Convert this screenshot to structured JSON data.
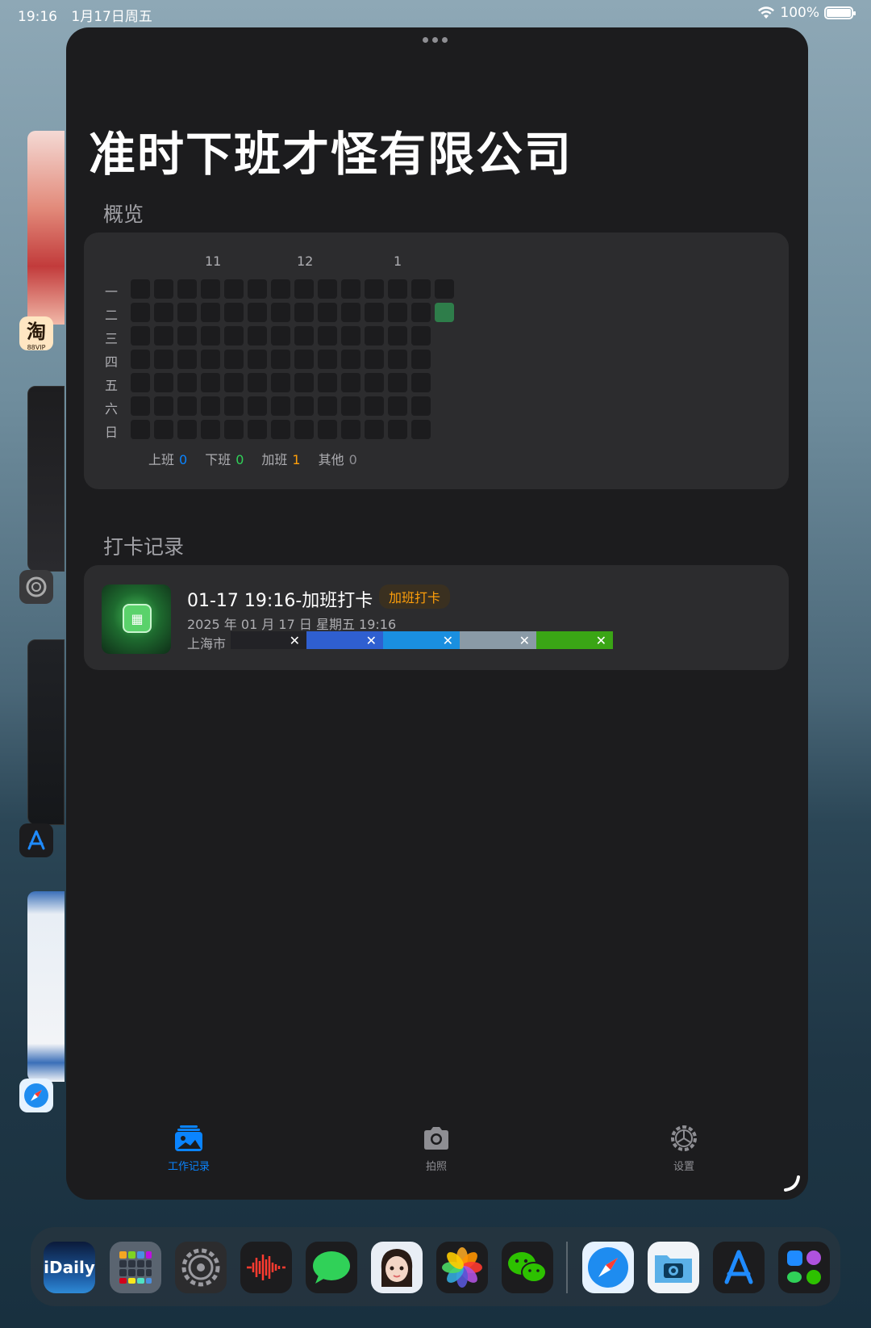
{
  "status_bar": {
    "time": "19:16",
    "date": "1月17日周五",
    "battery": "100%"
  },
  "window": {
    "title": "准时下班才怪有限公司"
  },
  "overview": {
    "heading": "概览",
    "months": [
      "11",
      "12",
      "1"
    ],
    "weekdays": [
      "一",
      "二",
      "三",
      "四",
      "五",
      "六",
      "日"
    ],
    "legend": [
      {
        "label": "上班",
        "value": "0",
        "color": "#0a84ff"
      },
      {
        "label": "下班",
        "value": "0",
        "color": "#30d158"
      },
      {
        "label": "加班",
        "value": "1",
        "color": "#ff9f0a"
      },
      {
        "label": "其他",
        "value": "0",
        "color": "#8e8e93"
      }
    ]
  },
  "records": {
    "heading": "打卡记录",
    "items": [
      {
        "title": "01-17 19:16-加班打卡",
        "badge": "加班打卡",
        "datetime": "2025 年 01 月 17 日  星期五 19:16",
        "location": "上海市"
      }
    ]
  },
  "tabs": [
    {
      "label": "工作记录",
      "icon": "photo-stack-icon",
      "active": true
    },
    {
      "label": "拍照",
      "icon": "camera-icon",
      "active": false
    },
    {
      "label": "设置",
      "icon": "gear-icon",
      "active": false
    }
  ],
  "dock": {
    "first_app_label": "iDaily"
  },
  "side_apps": {
    "taobao_icon_text": "淘",
    "taobao_badge": "88VIP"
  },
  "colors": {
    "accent": "#0a84ff",
    "active_cell": "#2e7d4a",
    "overtime": "#ff9f0a"
  }
}
